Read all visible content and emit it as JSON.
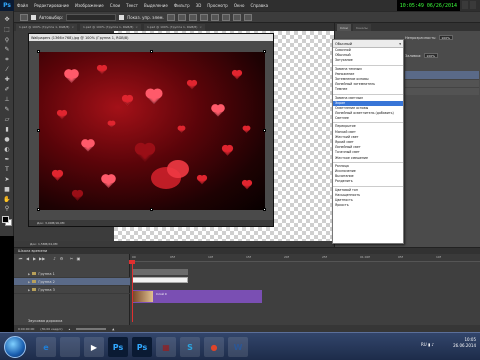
{
  "menubar": {
    "app_logo": "Ps",
    "items": [
      "Файл",
      "Редактирование",
      "Изображение",
      "Слои",
      "Текст",
      "Выделение",
      "Фильтр",
      "3D",
      "Просмотр",
      "Окно",
      "Справка"
    ],
    "clock": "10:05:49 06/26/2014"
  },
  "options_bar": {
    "autoselect_label": "Автовыбор:",
    "show_controls_label": "Показ. упр. элем."
  },
  "doc_tabs": [
    "1.psd @ 100% (Группа 1, RGB/8)",
    "1.psd @ 100% (Группа 1, RGB/8)",
    "1.psd @ 100% (Группа 1, RGB/8)"
  ],
  "toolbar": {
    "tools": [
      "move-tool",
      "marquee-tool",
      "lasso-tool",
      "quick-select-tool",
      "crop-tool",
      "eyedropper-tool",
      "healing-tool",
      "brush-tool",
      "clone-tool",
      "history-brush-tool",
      "eraser-tool",
      "gradient-tool",
      "blur-tool",
      "dodge-tool",
      "pen-tool",
      "type-tool",
      "path-select-tool",
      "shape-tool",
      "hand-tool",
      "zoom-tool"
    ]
  },
  "document": {
    "title": "Wallpapers (1366×768).jpg @ 100% (Группа 1, RGB/8)",
    "status": "Док: 3,00M/16,0M"
  },
  "workspace_status": "Док: 1,58M/24,0M",
  "right_panel": {
    "tabs": [
      "Слои",
      "Каналы"
    ],
    "opacity_label": "Непрозрачность:",
    "opacity_value": "100%",
    "fill_label": "Заливка:",
    "fill_value": "100%"
  },
  "blend_dropdown": {
    "current": "Обычный",
    "groups": [
      [
        "Сквозной",
        "Обычный",
        "Затухание"
      ],
      [
        "Замена темным",
        "Умножение",
        "Затемнение основы",
        "Линейный затемнитель",
        "Темнее"
      ],
      [
        "Замена светлым",
        "Экран",
        "Осветление основы",
        "Линейный осветлитель (добавить)",
        "Светлее"
      ],
      [
        "Перекрытие",
        "Мягкий свет",
        "Жесткий свет",
        "Яркий свет",
        "Линейный свет",
        "Точечный свет",
        "Жесткое смешение"
      ],
      [
        "Разница",
        "Исключение",
        "Вычитание",
        "Разделить"
      ],
      [
        "Цветовой тон",
        "Насыщенность",
        "Цветность",
        "Яркость"
      ]
    ],
    "selected": "Экран"
  },
  "timeline": {
    "title": "Шкала времени",
    "time": "0:00:00:00",
    "fps": "(30,00 кадр/с)",
    "ruler_labels": [
      "00",
      "05f",
      "10f",
      "15f",
      "20f",
      "25f",
      "01:00f",
      "05f",
      "10f"
    ],
    "layers": [
      "Группа 1",
      "Группа 2",
      "Группа 3"
    ],
    "selected_layer": "Группа 2",
    "clip_label": "Слой 0",
    "audio_label": "Звуковая дорожка"
  },
  "taskbar": {
    "time": "10:05",
    "date": "26.06.2014",
    "lang": "RU",
    "apps": [
      {
        "label": "e",
        "color": "#1e7fd8"
      },
      {
        "label": "",
        "color": "#f2c84b"
      },
      {
        "label": "▶",
        "color": "#ffffff"
      },
      {
        "label": "Ps",
        "color": "#31a8ff"
      },
      {
        "label": "Ps",
        "color": "#31a8ff"
      },
      {
        "label": "▦",
        "color": "#9b1b1b"
      },
      {
        "label": "S",
        "color": "#2aa5e0"
      },
      {
        "label": "●",
        "color": "#e0452a"
      },
      {
        "label": "W",
        "color": "#2b5797"
      }
    ]
  }
}
